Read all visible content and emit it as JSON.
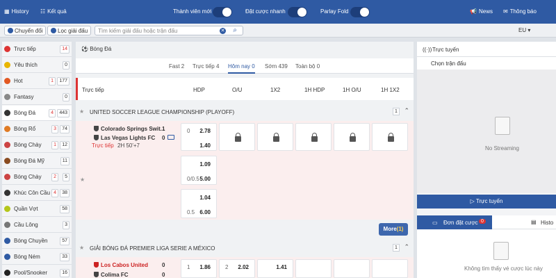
{
  "topbar": {
    "history": "History",
    "results": "Kết quả",
    "new_member": "Thành viên mới",
    "quick_bet": "Đặt cược nhanh",
    "parlay_fold": "Parlay Fold",
    "news": "News",
    "notifications": "Thông báo",
    "brand_color": "#2f5aa3"
  },
  "search": {
    "switch_label": "Chuyển đổi",
    "filter_label": "Lọc giải đấu",
    "placeholder": "Tìm kiếm giải đấu hoặc trận đấu",
    "odds_format": "EU"
  },
  "sidebar": {
    "items": [
      {
        "label": "Trực tiếp",
        "badge": "14",
        "badge_red": true,
        "icon": "live-icon",
        "color": "#d33"
      },
      {
        "label": "Yêu thích",
        "badge": "0",
        "icon": "star-icon",
        "color": "#e8b500"
      },
      {
        "label": "Hot",
        "badge_a": "1",
        "badge": "177",
        "icon": "fire-icon",
        "color": "#e25822"
      },
      {
        "label": "Fantasy",
        "badge": "0",
        "icon": "fantasy-icon",
        "color": "#888"
      },
      {
        "label": "Bóng Đá",
        "badge_a": "4",
        "badge": "443",
        "icon": "soccer-ball-icon",
        "color": "#333"
      },
      {
        "label": "Bóng Rổ",
        "badge_a": "3",
        "badge": "74",
        "icon": "basketball-icon",
        "color": "#e07b24"
      },
      {
        "label": "Bóng Chày",
        "badge_a": "1",
        "badge": "12",
        "icon": "baseball-icon",
        "color": "#c44"
      },
      {
        "label": "Bóng Đá Mỹ",
        "badge": "11",
        "icon": "american-football-icon",
        "color": "#8a4b20"
      },
      {
        "label": "Bóng Chày",
        "badge_a": "2",
        "badge": "5",
        "icon": "baseball-icon",
        "color": "#c44"
      },
      {
        "label": "Khúc Côn Cầu",
        "badge_a": "4",
        "badge": "38",
        "icon": "hockey-icon",
        "color": "#333"
      },
      {
        "label": "Quần Vợt",
        "badge": "58",
        "icon": "tennis-icon",
        "color": "#b5c61a"
      },
      {
        "label": "Cầu Lông",
        "badge": "3",
        "icon": "badminton-icon",
        "color": "#777"
      },
      {
        "label": "Bóng Chuyền",
        "badge": "57",
        "icon": "volleyball-icon",
        "color": "#2f5aa3"
      },
      {
        "label": "Bóng Ném",
        "badge": "33",
        "icon": "handball-icon",
        "color": "#2f5aa3"
      },
      {
        "label": "Pool/Snooker",
        "badge": "16",
        "icon": "snooker-icon",
        "color": "#222"
      }
    ]
  },
  "main": {
    "sport_title": "Bóng Đá",
    "tabs": [
      "Fast 2",
      "Trực tiếp 4",
      "Hôm nay 0",
      "Sớm 439",
      "Toàn bộ 0"
    ],
    "header": {
      "section": "Trực tiếp",
      "cols": [
        "HDP",
        "O/U",
        "1X2",
        "1H HDP",
        "1H O/U",
        "1H 1X2"
      ]
    },
    "leagues": [
      {
        "name": "UNITED SOCCER LEAGUE CHAMPIONSHIP (PLAYOFF)",
        "count": "1",
        "match": {
          "home": "Colorado Springs Swit...",
          "away": "Las Vegas Lights FC",
          "home_score": "1",
          "away_score": "0",
          "status": "Trực tiếp",
          "clock": "2H 50'+7",
          "rows": [
            {
              "hdp_line": "0",
              "hdp_home": "2.78",
              "hdp_away": "1.40"
            },
            {
              "hdp_home": "1.09",
              "hdp_line": "0/0.5",
              "hdp_away": "5.00"
            },
            {
              "hdp_home": "1.04",
              "hdp_line": "0.5",
              "hdp_away": "6.00"
            }
          ],
          "more_label": "More",
          "more_count": "(1)"
        }
      },
      {
        "name": "GIẢI BÓNG ĐÁ PREMIER LIGA SERIE A MÉXICO",
        "count": "1",
        "match": {
          "home": "Los Cabos United",
          "away": "Colima FC",
          "home_score": "0",
          "away_score": "0",
          "hdp_line": "1",
          "hdp_home": "1.86",
          "ou_line": "2",
          "ou_over": "2.02",
          "x12_home": "1.41"
        }
      }
    ]
  },
  "right": {
    "title": "Trực tuyến",
    "select_match": "Chọn trận đấu",
    "no_streaming": "No Streaming",
    "live_button": "Trực tuyến",
    "bet_slip_tab": "Đơn đặt cược",
    "bet_slip_count": "0",
    "history_tab": "Histo",
    "empty_text": "Không tìm thấy vé cược lúc này"
  }
}
